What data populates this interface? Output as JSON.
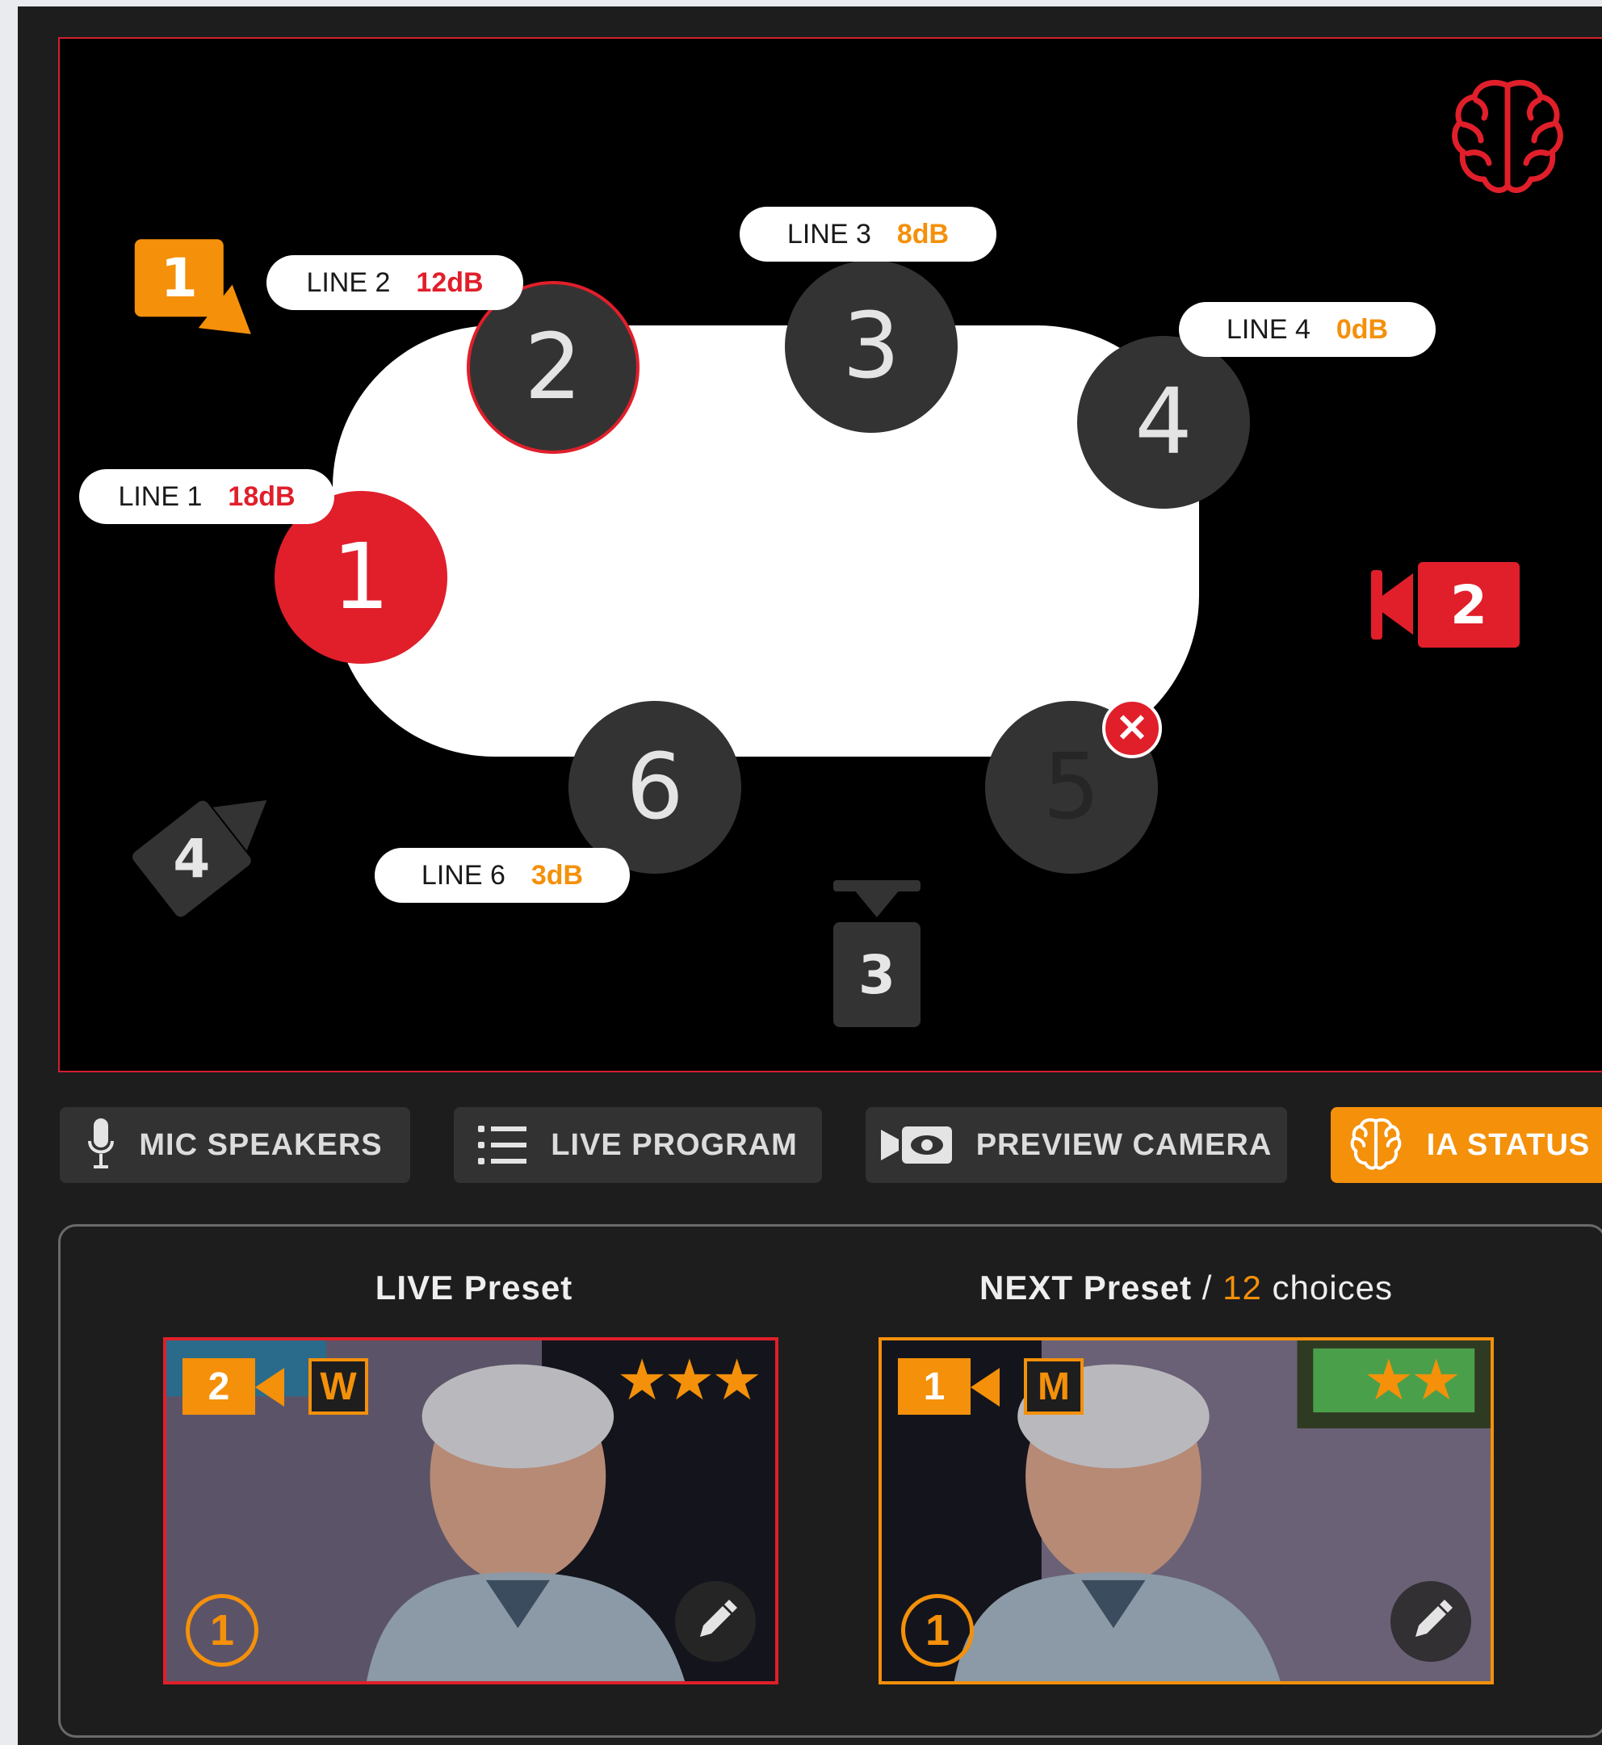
{
  "colors": {
    "accent_red": "#e01f2b",
    "accent_orange": "#f4900a",
    "seat_dark": "#333333"
  },
  "seats": [
    {
      "id": "1",
      "line": "LINE 1",
      "level": "18dB",
      "level_color": "#e01f2b",
      "state": "speaking"
    },
    {
      "id": "2",
      "line": "LINE 2",
      "level": "12dB",
      "level_color": "#e01f2b",
      "state": "ringed"
    },
    {
      "id": "3",
      "line": "LINE 3",
      "level": "8dB",
      "level_color": "#f4900a",
      "state": "idle"
    },
    {
      "id": "4",
      "line": "LINE 4",
      "level": "0dB",
      "level_color": "#f4900a",
      "state": "idle"
    },
    {
      "id": "5",
      "state": "disabled"
    },
    {
      "id": "6",
      "line": "LINE 6",
      "level": "3dB",
      "level_color": "#f4900a",
      "state": "idle"
    }
  ],
  "cameras": [
    {
      "id": "1",
      "color": "#f4900a"
    },
    {
      "id": "2",
      "color": "#e01f2b"
    },
    {
      "id": "3",
      "color": "#333333"
    },
    {
      "id": "4",
      "color": "#333333"
    }
  ],
  "icons": {
    "brain": "brain-icon",
    "error": "close-icon"
  },
  "error_glyph": "✕",
  "toolbar": {
    "mic_speakers": "MIC SPEAKERS",
    "live_program": "LIVE PROGRAM",
    "preview_camera": "PREVIEW CAMERA",
    "ia_status": "IA STATUS",
    "active": "ia_status"
  },
  "presets": {
    "live": {
      "title": "LIVE Preset",
      "camera": "2",
      "shot": "W",
      "rating": 3,
      "speaker": "1"
    },
    "next": {
      "title_prefix": "NEXT Preset",
      "separator": " / ",
      "choices_count": "12",
      "choices_label": " choices",
      "camera": "1",
      "shot": "M",
      "rating": 2,
      "speaker": "1"
    }
  }
}
